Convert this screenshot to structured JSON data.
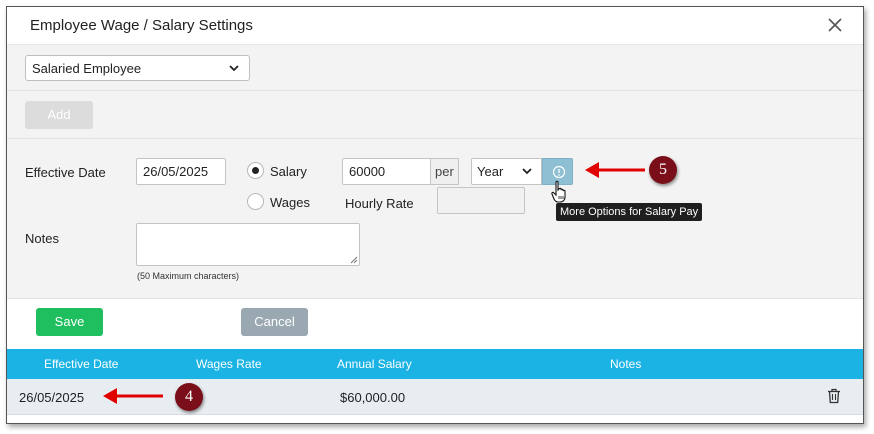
{
  "dialog": {
    "title": "Employee Wage / Salary Settings"
  },
  "employee_type": {
    "selected": "Salaried Employee"
  },
  "toolbar": {
    "add_label": "Add"
  },
  "form": {
    "effective_date_label": "Effective Date",
    "effective_date_value": "26/05/2025",
    "salary_option_label": "Salary",
    "wages_option_label": "Wages",
    "selected_pay_type": "Salary",
    "amount_value": "60000",
    "per_label": "per",
    "period_selected": "Year",
    "hourly_rate_label": "Hourly Rate",
    "hourly_rate_value": "",
    "info_tooltip": "More Options for Salary Pay",
    "notes_label": "Notes",
    "notes_value": "",
    "notes_hint": "(50 Maximum characters)"
  },
  "actions": {
    "save_label": "Save",
    "cancel_label": "Cancel"
  },
  "table": {
    "columns": [
      "Effective Date",
      "Wages Rate",
      "Annual Salary",
      "Notes"
    ],
    "rows": [
      {
        "effective_date": "26/05/2025",
        "wages_rate": "",
        "annual_salary": "$60,000.00",
        "notes": ""
      }
    ]
  },
  "annotations": {
    "badge_row": "4",
    "badge_info": "5",
    "color": "#7a0f1a",
    "arrow_color": "#e00000"
  },
  "colors": {
    "save": "#1fbf5f",
    "cancel": "#9aa8b2",
    "table_header": "#1ab3e3",
    "info_button": "#8fbfd3"
  }
}
